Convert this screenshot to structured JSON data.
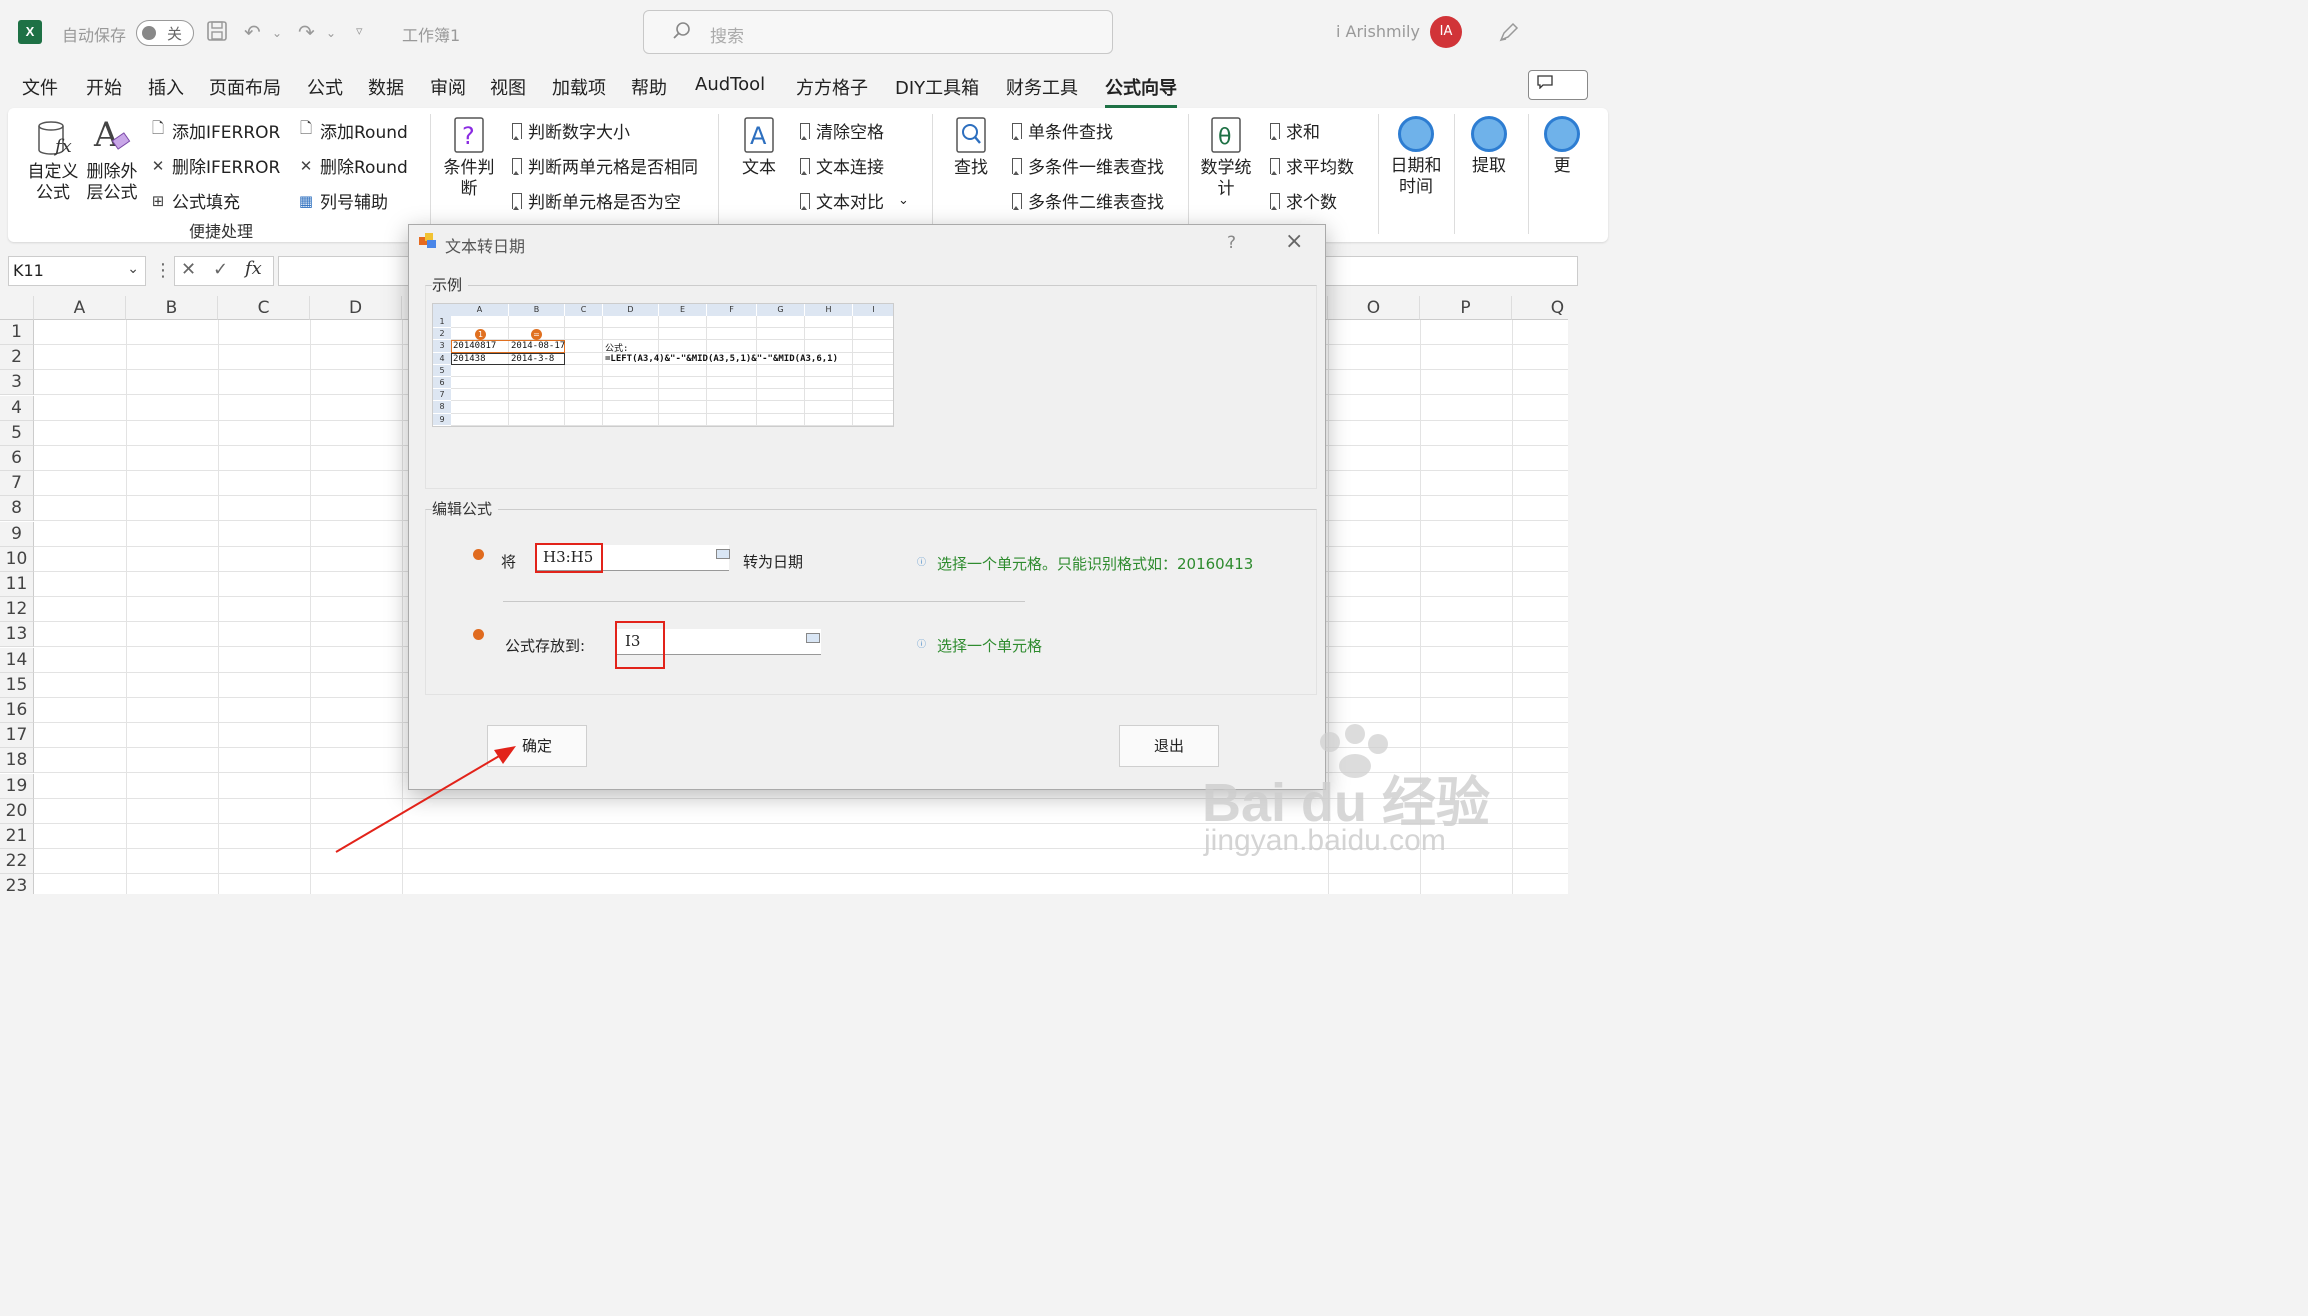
{
  "titlebar": {
    "app_logo": "X",
    "autosave_label": "自动保存",
    "autosave_state": "关",
    "doc_name": "工作簿1",
    "search_placeholder": "搜索",
    "user_name": "i Arishmily",
    "avatar_initials": "IA"
  },
  "tabs": [
    "文件",
    "开始",
    "插入",
    "页面布局",
    "公式",
    "数据",
    "审阅",
    "视图",
    "加载项",
    "帮助",
    "AudTool",
    "方方格子",
    "DIY工具箱",
    "财务工具",
    "公式向导"
  ],
  "active_tab": "公式向导",
  "ribbon": {
    "custom_formula": "自定义公式",
    "remove_outer": "删除外层公式",
    "add_iferror": "添加IFERROR",
    "del_iferror": "删除IFERROR",
    "formula_fill": "公式填充",
    "add_round": "添加Round",
    "del_round": "删除Round",
    "col_helper": "列号辅助",
    "group_convenient": "便捷处理",
    "cond_judge": "条件判断",
    "judge_num_size": "判断数字大小",
    "judge_two_same": "判断两单元格是否相同",
    "judge_empty": "判断单元格是否为空",
    "text": "文本",
    "clear_space": "清除空格",
    "text_join": "文本连接",
    "text_compare": "文本对比",
    "find": "查找",
    "single_find": "单条件查找",
    "multi_1d": "多条件一维表查找",
    "multi_2d": "多条件二维表查找",
    "math_stat": "数学统计",
    "sum": "求和",
    "avg": "求平均数",
    "count": "求个数",
    "datetime": "日期和时间",
    "extract": "提取",
    "more": "更"
  },
  "formula_bar": {
    "name_box": "K11",
    "fx": "fx"
  },
  "grid": {
    "columns": [
      "A",
      "B",
      "C",
      "D",
      "O",
      "P",
      "Q"
    ],
    "rows": [
      "1",
      "2",
      "3",
      "4",
      "5",
      "6",
      "7",
      "8",
      "9",
      "10",
      "11",
      "12",
      "13",
      "14",
      "15",
      "16",
      "17",
      "18",
      "19",
      "20",
      "21",
      "22",
      "23"
    ]
  },
  "dialog": {
    "title": "文本转日期",
    "help": "?",
    "close": "×",
    "sample_legend": "示例",
    "sample": {
      "cols": [
        "A",
        "B",
        "C",
        "D",
        "E",
        "F",
        "G",
        "H",
        "I"
      ],
      "rows": [
        "1",
        "2",
        "3",
        "4",
        "5",
        "6",
        "7",
        "8",
        "9"
      ],
      "badge1": "1",
      "badge2": "=",
      "a3": "20140817",
      "b3": "2014-08-17",
      "a4": "201438",
      "b4": "2014-3-8",
      "formula_label": "公式:",
      "formula": "=LEFT(A3,4)&\"-\"&MID(A3,5,1)&\"-\"&MID(A3,6,1)"
    },
    "edit_legend": "编辑公式",
    "convert_prefix": "将",
    "convert_suffix": "转为日期",
    "range_value": "H3:H5",
    "range_hint": "选择一个单元格。只能识别格式如：20160413",
    "store_label": "公式存放到:",
    "store_value": "I3",
    "store_hint": "选择一个单元格",
    "ok": "确定",
    "exit": "退出"
  },
  "watermark": {
    "brand": "Bai du 经验",
    "url": "jingyan.baidu.com"
  },
  "colors": {
    "accent": "#1e7145",
    "highlight": "#e2231a",
    "hint": "#2e8b2e"
  }
}
